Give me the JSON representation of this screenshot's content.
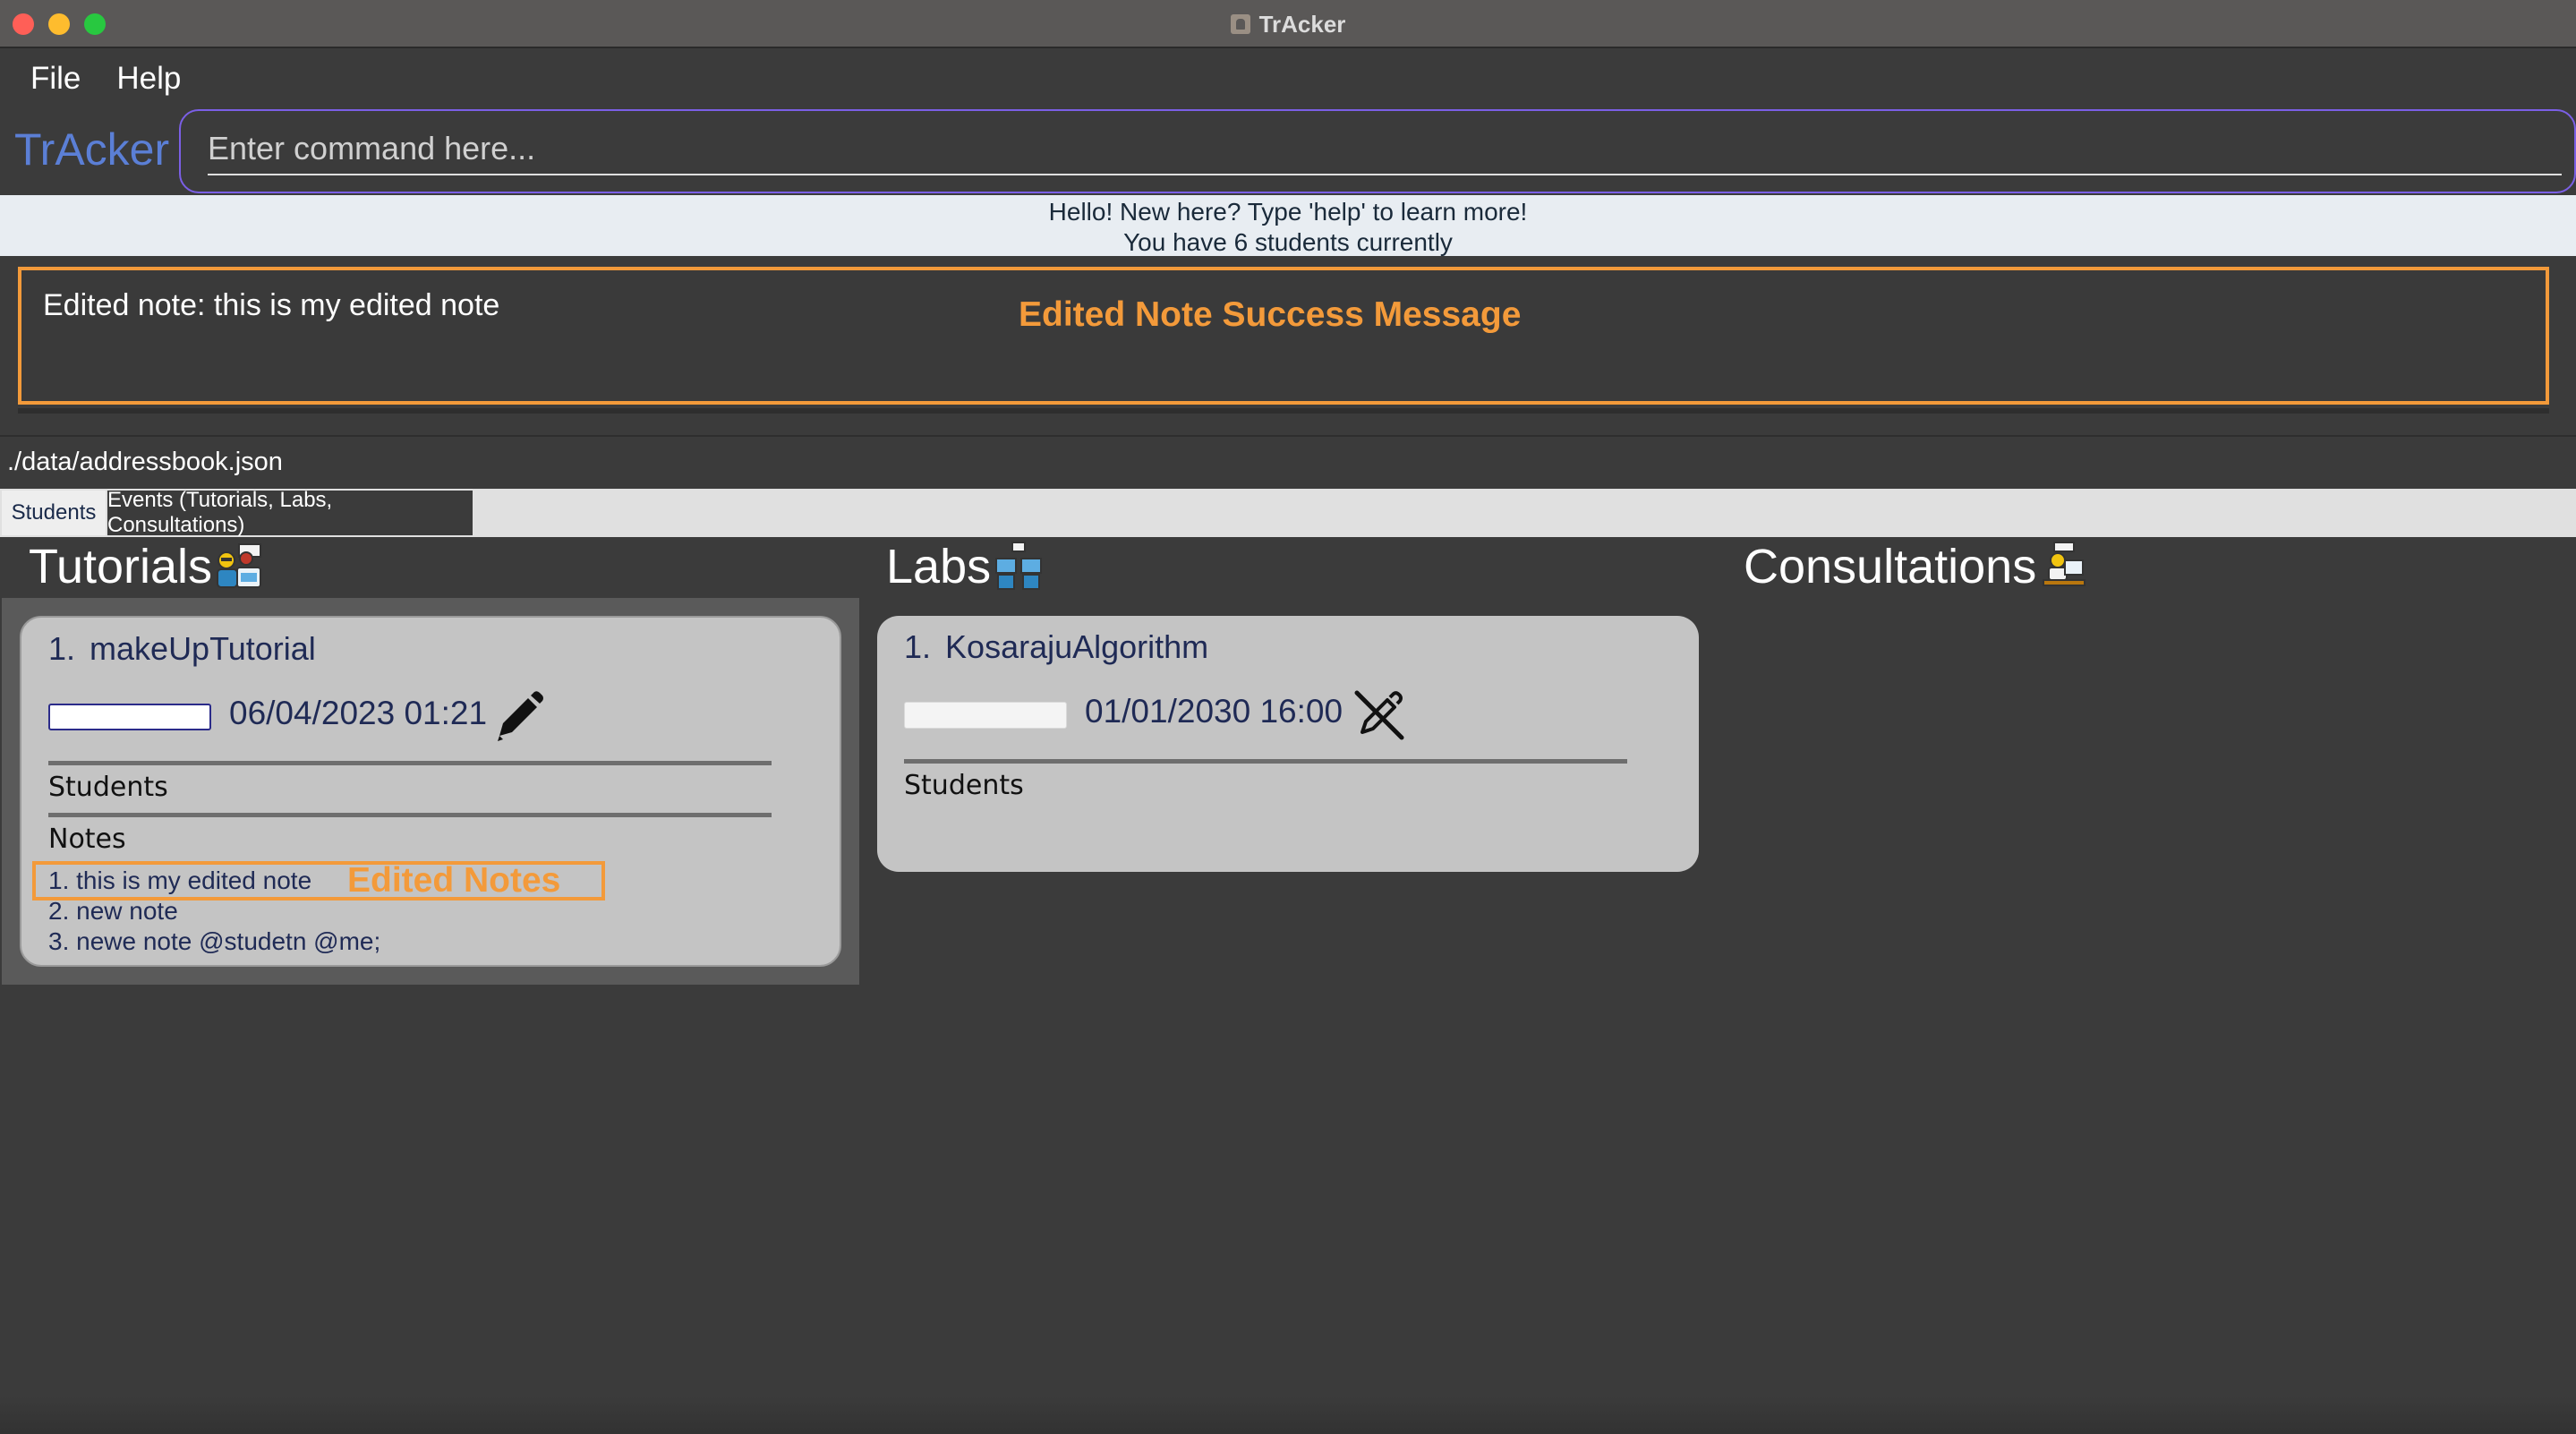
{
  "window": {
    "title": "TrAcker"
  },
  "menu": {
    "items": [
      {
        "label": "File"
      },
      {
        "label": "Help"
      }
    ]
  },
  "command": {
    "brand": "TrAcker",
    "placeholder": "Enter command here...",
    "value": ""
  },
  "welcome": {
    "line1": "Hello! New here? Type 'help' to learn more!",
    "line2": "You have 6 students currently"
  },
  "result": {
    "message": "Edited note: this is my edited note",
    "annotation": "Edited Note Success Message"
  },
  "status": {
    "path": "./data/addressbook.json"
  },
  "tabs": [
    {
      "label": "Students",
      "selected": false
    },
    {
      "label": "Events (Tutorials, Labs, Consultations)",
      "selected": true
    }
  ],
  "columns": {
    "tutorials": {
      "title": "Tutorials",
      "icon": "tutorial-people-icon",
      "events": [
        {
          "index": "1.",
          "name": "makeUpTutorial",
          "datetime": "06/04/2023 01:21",
          "status_icon": "pencil-icon",
          "students_label": "Students",
          "notes_label": "Notes",
          "notes": [
            "1. this is my edited note",
            "2. new note",
            "3. newe note @studetn @me;"
          ],
          "annotation": "Edited Notes"
        }
      ]
    },
    "labs": {
      "title": "Labs",
      "icon": "lab-computers-icon",
      "events": [
        {
          "index": "1.",
          "name": "KosarajuAlgorithm",
          "datetime": "01/01/2030 16:00",
          "status_icon": "pencil-off-icon",
          "students_label": "Students"
        }
      ]
    },
    "consultations": {
      "title": "Consultations",
      "icon": "consultation-desk-icon",
      "events": []
    }
  },
  "colors": {
    "background": "#3b3b3b",
    "brand": "#5b7fd6",
    "command_border": "#7b5fe6",
    "annotation": "#f39a3a",
    "card": "#c4c4c4",
    "card_text": "#1f2a55"
  }
}
